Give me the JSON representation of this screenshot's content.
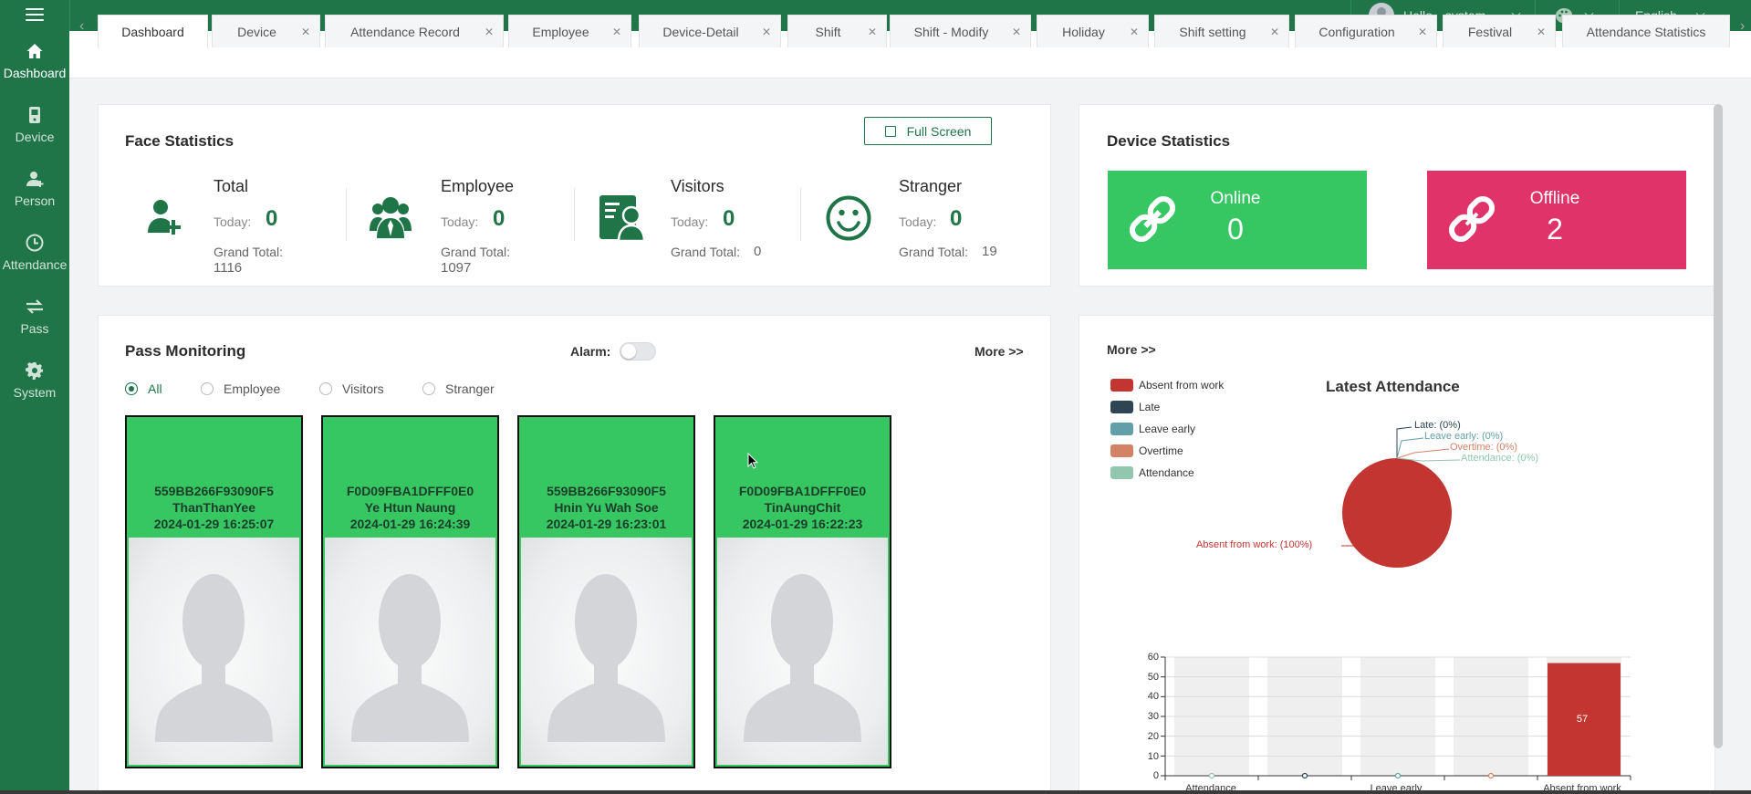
{
  "header": {
    "greeting": "Hello，system",
    "language": "English"
  },
  "sidebar": {
    "items": [
      {
        "label": "Dashboard",
        "icon": "home-icon",
        "active": true
      },
      {
        "label": "Device",
        "icon": "device-icon"
      },
      {
        "label": "Person",
        "icon": "person-icon"
      },
      {
        "label": "Attendance",
        "icon": "clock-icon"
      },
      {
        "label": "Pass",
        "icon": "transfer-icon"
      },
      {
        "label": "System",
        "icon": "gear-icon"
      }
    ]
  },
  "tabs": [
    {
      "label": "Dashboard",
      "active": true,
      "closable": false
    },
    {
      "label": "Device",
      "closable": true
    },
    {
      "label": "Attendance Record",
      "closable": true
    },
    {
      "label": "Employee",
      "closable": true
    },
    {
      "label": "Device-Detail",
      "closable": true
    },
    {
      "label": "Shift",
      "closable": true
    },
    {
      "label": "Shift - Modify",
      "closable": true
    },
    {
      "label": "Holiday",
      "closable": true
    },
    {
      "label": "Shift setting",
      "closable": true
    },
    {
      "label": "Configuration",
      "closable": true
    },
    {
      "label": "Festival",
      "closable": true
    },
    {
      "label": "Attendance Statistics",
      "closable": false
    }
  ],
  "tab_arrows": {
    "left": "‹",
    "right": "›"
  },
  "face_stats": {
    "title": "Face Statistics",
    "fullscreen_label": "Full Screen",
    "today_label": "Today:",
    "grand_label": "Grand Total:",
    "items": [
      {
        "name": "Total",
        "today": "0",
        "grand": "1116"
      },
      {
        "name": "Employee",
        "today": "0",
        "grand": "1097"
      },
      {
        "name": "Visitors",
        "today": "0",
        "grand": "0"
      },
      {
        "name": "Stranger",
        "today": "0",
        "grand": "19"
      }
    ]
  },
  "device_stats": {
    "title": "Device Statistics",
    "online_label": "Online",
    "online_value": "0",
    "offline_label": "Offline",
    "offline_value": "2",
    "colors": {
      "online": "#37c762",
      "offline": "#e0336a"
    }
  },
  "pass_monitoring": {
    "title": "Pass Monitoring",
    "alarm_label": "Alarm:",
    "alarm_on": false,
    "more_label": "More >>",
    "filters": [
      {
        "label": "All",
        "checked": true
      },
      {
        "label": "Employee"
      },
      {
        "label": "Visitors"
      },
      {
        "label": "Stranger"
      }
    ],
    "cards": [
      {
        "device": "559BB266F93090F5",
        "name": "ThanThanYee",
        "time": "2024-01-29 16:25:07"
      },
      {
        "device": "F0D09FBA1DFFF0E0",
        "name": "Ye Htun Naung",
        "time": "2024-01-29 16:24:39"
      },
      {
        "device": "559BB266F93090F5",
        "name": "Hnin Yu Wah Soe",
        "time": "2024-01-29 16:23:01"
      },
      {
        "device": "F0D09FBA1DFFF0E0",
        "name": "TinAungChit",
        "time": "2024-01-29 16:22:23"
      }
    ]
  },
  "attendance_panel": {
    "more_label": "More >>"
  },
  "chart_data": [
    {
      "type": "pie",
      "title": "Latest Attendance",
      "legend_position": "top-left",
      "slices": [
        {
          "name": "Absent from work",
          "value": 100,
          "label": "Absent from work: (100%)",
          "color": "#c23531"
        },
        {
          "name": "Late",
          "value": 0,
          "label": "Late: (0%)",
          "color": "#2f4554"
        },
        {
          "name": "Leave early",
          "value": 0,
          "label": "Leave early: (0%)",
          "color": "#61a0a8"
        },
        {
          "name": "Overtime",
          "value": 0,
          "label": "Overtime: (0%)",
          "color": "#d48265"
        },
        {
          "name": "Attendance",
          "value": 0,
          "label": "Attendance: (0%)",
          "color": "#91c7ae"
        }
      ]
    },
    {
      "type": "bar",
      "categories": [
        "Attendance",
        "Late",
        "Leave early",
        "Overtime",
        "Absent from work"
      ],
      "x_tick_labels": [
        "Attendance",
        "",
        "Leave early",
        "",
        "Absent from work"
      ],
      "values": [
        0,
        0,
        0,
        0,
        57
      ],
      "colors": [
        "#91c7ae",
        "#2f4554",
        "#61a0a8",
        "#d48265",
        "#c23531"
      ],
      "ylim": [
        0,
        60
      ],
      "yticks": [
        0,
        10,
        20,
        30,
        40,
        50,
        60
      ],
      "grid": true,
      "data_labels": [
        "0",
        "0",
        "0",
        "0",
        "57"
      ]
    }
  ]
}
